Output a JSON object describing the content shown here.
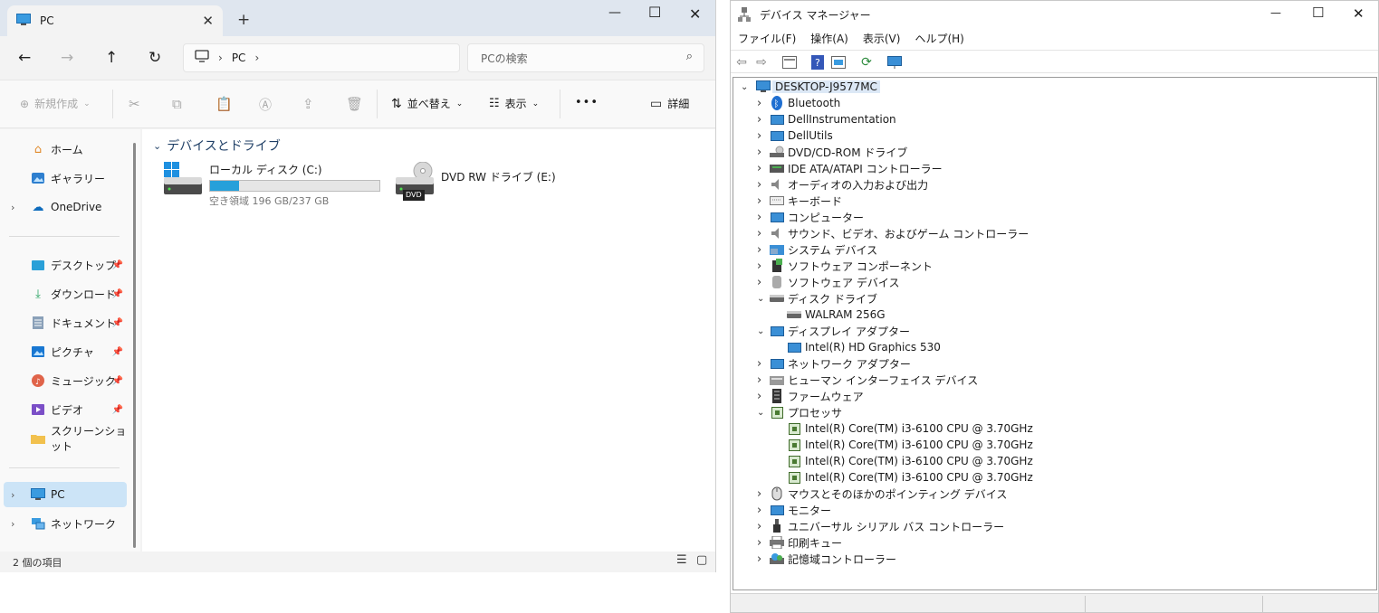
{
  "explorer": {
    "tab_title": "PC",
    "address_segment": "PC",
    "search_placeholder": "PCの検索",
    "commands": {
      "new": "新規作成",
      "sort": "並べ替え",
      "view": "表示",
      "more": "•••",
      "details": "詳細"
    },
    "nav": {
      "home": "ホーム",
      "gallery": "ギャラリー",
      "onedrive": "OneDrive",
      "desktop": "デスクトップ",
      "downloads": "ダウンロード",
      "documents": "ドキュメント",
      "pictures": "ピクチャ",
      "music": "ミュージック",
      "videos": "ビデオ",
      "screenshots": "スクリーンショット",
      "pc": "PC",
      "network": "ネットワーク"
    },
    "group_header": "デバイスとドライブ",
    "drives": [
      {
        "name": "ローカル ディスク (C:)",
        "free_text": "空き領域 196 GB/237 GB",
        "used_fraction": 0.17
      },
      {
        "name": "DVD RW ドライブ (E:)",
        "badge": "DVD"
      }
    ],
    "status_text": "2 個の項目"
  },
  "devmgr": {
    "title": "デバイス マネージャー",
    "menu": [
      "ファイル(F)",
      "操作(A)",
      "表示(V)",
      "ヘルプ(H)"
    ],
    "root": "DESKTOP-J9577MC",
    "tree": [
      {
        "label": "Bluetooth",
        "level": 1,
        "state": "collapsed",
        "icon": "bluetooth"
      },
      {
        "label": "DellInstrumentation",
        "level": 1,
        "state": "collapsed",
        "icon": "monitor"
      },
      {
        "label": "DellUtils",
        "level": 1,
        "state": "collapsed",
        "icon": "monitor"
      },
      {
        "label": "DVD/CD-ROM ドライブ",
        "level": 1,
        "state": "collapsed",
        "icon": "dvd"
      },
      {
        "label": "IDE ATA/ATAPI コントローラー",
        "level": 1,
        "state": "collapsed",
        "icon": "controller"
      },
      {
        "label": "オーディオの入力および出力",
        "level": 1,
        "state": "collapsed",
        "icon": "speaker"
      },
      {
        "label": "キーボード",
        "level": 1,
        "state": "collapsed",
        "icon": "keyboard"
      },
      {
        "label": "コンピューター",
        "level": 1,
        "state": "collapsed",
        "icon": "monitor"
      },
      {
        "label": "サウンド、ビデオ、およびゲーム コントローラー",
        "level": 1,
        "state": "collapsed",
        "icon": "speaker"
      },
      {
        "label": "システム デバイス",
        "level": 1,
        "state": "collapsed",
        "icon": "folder"
      },
      {
        "label": "ソフトウェア コンポーネント",
        "level": 1,
        "state": "collapsed",
        "icon": "component"
      },
      {
        "label": "ソフトウェア デバイス",
        "level": 1,
        "state": "collapsed",
        "icon": "cylinder"
      },
      {
        "label": "ディスク ドライブ",
        "level": 1,
        "state": "expanded",
        "icon": "disk"
      },
      {
        "label": "WALRAM 256G",
        "level": 2,
        "state": "leaf",
        "icon": "disk"
      },
      {
        "label": "ディスプレイ アダプター",
        "level": 1,
        "state": "expanded",
        "icon": "monitor"
      },
      {
        "label": "Intel(R) HD Graphics 530",
        "level": 2,
        "state": "leaf",
        "icon": "monitor"
      },
      {
        "label": "ネットワーク アダプター",
        "level": 1,
        "state": "collapsed",
        "icon": "monitor"
      },
      {
        "label": "ヒューマン インターフェイス デバイス",
        "level": 1,
        "state": "collapsed",
        "icon": "hid"
      },
      {
        "label": "ファームウェア",
        "level": 1,
        "state": "collapsed",
        "icon": "firmware"
      },
      {
        "label": "プロセッサ",
        "level": 1,
        "state": "expanded",
        "icon": "chip"
      },
      {
        "label": "Intel(R) Core(TM) i3-6100 CPU @ 3.70GHz",
        "level": 2,
        "state": "leaf",
        "icon": "chip"
      },
      {
        "label": "Intel(R) Core(TM) i3-6100 CPU @ 3.70GHz",
        "level": 2,
        "state": "leaf",
        "icon": "chip"
      },
      {
        "label": "Intel(R) Core(TM) i3-6100 CPU @ 3.70GHz",
        "level": 2,
        "state": "leaf",
        "icon": "chip"
      },
      {
        "label": "Intel(R) Core(TM) i3-6100 CPU @ 3.70GHz",
        "level": 2,
        "state": "leaf",
        "icon": "chip"
      },
      {
        "label": "マウスとそのほかのポインティング デバイス",
        "level": 1,
        "state": "collapsed",
        "icon": "mouse"
      },
      {
        "label": "モニター",
        "level": 1,
        "state": "collapsed",
        "icon": "monitor"
      },
      {
        "label": "ユニバーサル シリアル バス コントローラー",
        "level": 1,
        "state": "collapsed",
        "icon": "usb"
      },
      {
        "label": "印刷キュー",
        "level": 1,
        "state": "collapsed",
        "icon": "printer"
      },
      {
        "label": "記憶域コントローラー",
        "level": 1,
        "state": "collapsed",
        "icon": "storage"
      }
    ]
  },
  "colors": {
    "accent": "#0067c0",
    "selection": "#cce4f7",
    "drive_bar": "#26a0da"
  }
}
